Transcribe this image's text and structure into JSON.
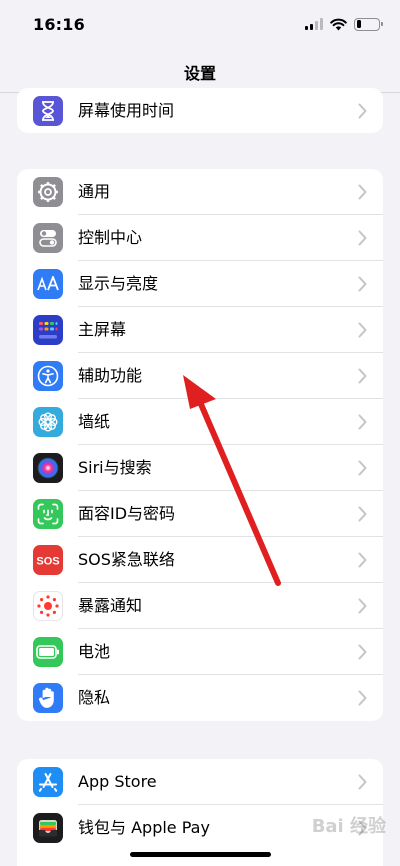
{
  "status_bar": {
    "time": "16:16"
  },
  "nav": {
    "title": "设置"
  },
  "groups": [
    {
      "items": [
        {
          "label": "屏幕使用时间",
          "icon": "hourglass-icon",
          "color": "#5856d6"
        }
      ]
    },
    {
      "items": [
        {
          "label": "通用",
          "icon": "gear-icon",
          "color": "#8e8e93"
        },
        {
          "label": "控制中心",
          "icon": "toggles-icon",
          "color": "#8e8e93"
        },
        {
          "label": "显示与亮度",
          "icon": "text-size-icon",
          "color": "#2f7cf6"
        },
        {
          "label": "主屏幕",
          "icon": "home-grid-icon",
          "color": "#2c3ec8"
        },
        {
          "label": "辅助功能",
          "icon": "accessibility-icon",
          "color": "#2f7cf6"
        },
        {
          "label": "墙纸",
          "icon": "flower-icon",
          "color": "#35aadc"
        },
        {
          "label": "Siri与搜索",
          "icon": "siri-icon",
          "color": "#222222"
        },
        {
          "label": "面容ID与密码",
          "icon": "face-id-icon",
          "color": "#34c759"
        },
        {
          "label": "SOS紧急联络",
          "icon": "sos-icon",
          "color": "#e53935"
        },
        {
          "label": "暴露通知",
          "icon": "exposure-icon",
          "color": "#ffffff"
        },
        {
          "label": "电池",
          "icon": "battery-icon",
          "color": "#34c759"
        },
        {
          "label": "隐私",
          "icon": "hand-icon",
          "color": "#2f7cf6"
        }
      ]
    },
    {
      "items": [
        {
          "label": "App Store",
          "icon": "app-store-icon",
          "color": "#1e8ef5"
        },
        {
          "label": "钱包与 Apple Pay",
          "icon": "wallet-icon",
          "color": "#1c1c1e"
        }
      ]
    }
  ],
  "watermark": "Bai 经验",
  "annotation": {
    "color": "#e02020"
  }
}
